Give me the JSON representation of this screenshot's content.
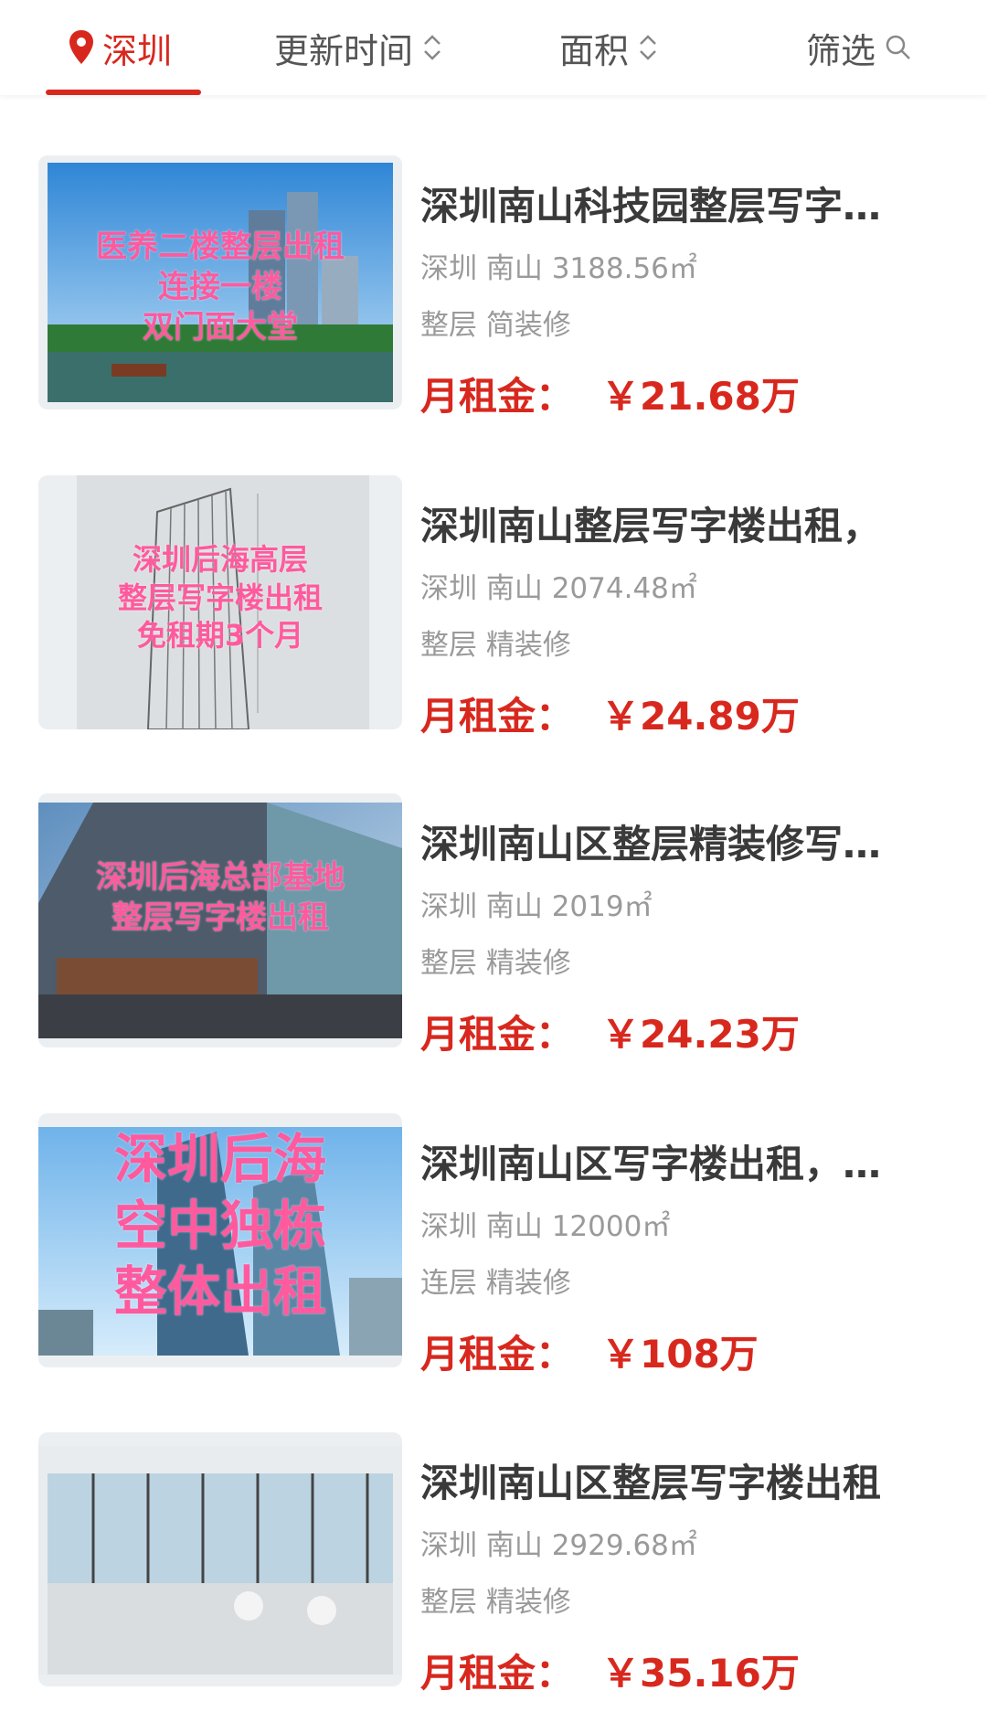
{
  "header": {
    "city": "深圳",
    "sort_update": "更新时间",
    "sort_area": "面积",
    "filter": "筛选"
  },
  "price_label": "月租金：",
  "listings": [
    {
      "title": "深圳南山科技园整层写字楼出租",
      "location": "深圳 南山 3188.56㎡",
      "tags": "整层 简装修",
      "price": "￥21.68万",
      "overlay": "医养二楼整层出租\n连接一楼\n双门面大堂"
    },
    {
      "title": "深圳南山整层写字楼出租，",
      "location": "深圳 南山 2074.48㎡",
      "tags": "整层 精装修",
      "price": "￥24.89万",
      "overlay": "深圳后海高层\n整层写字楼出租\n免租期3个月"
    },
    {
      "title": "深圳南山区整层精装修写字楼",
      "location": "深圳 南山 2019㎡",
      "tags": "整层 精装修",
      "price": "￥24.23万",
      "overlay": "深圳后海总部基地\n整层写字楼出租"
    },
    {
      "title": "深圳南山区写字楼出租，空中",
      "location": "深圳 南山 12000㎡",
      "tags": "连层 精装修",
      "price": "￥108万",
      "overlay": "深圳后海\n空中独栋\n整体出租"
    },
    {
      "title": "深圳南山区整层写字楼出租",
      "location": "深圳 南山 2929.68㎡",
      "tags": "整层 精装修",
      "price": "￥35.16万",
      "overlay": ""
    }
  ]
}
